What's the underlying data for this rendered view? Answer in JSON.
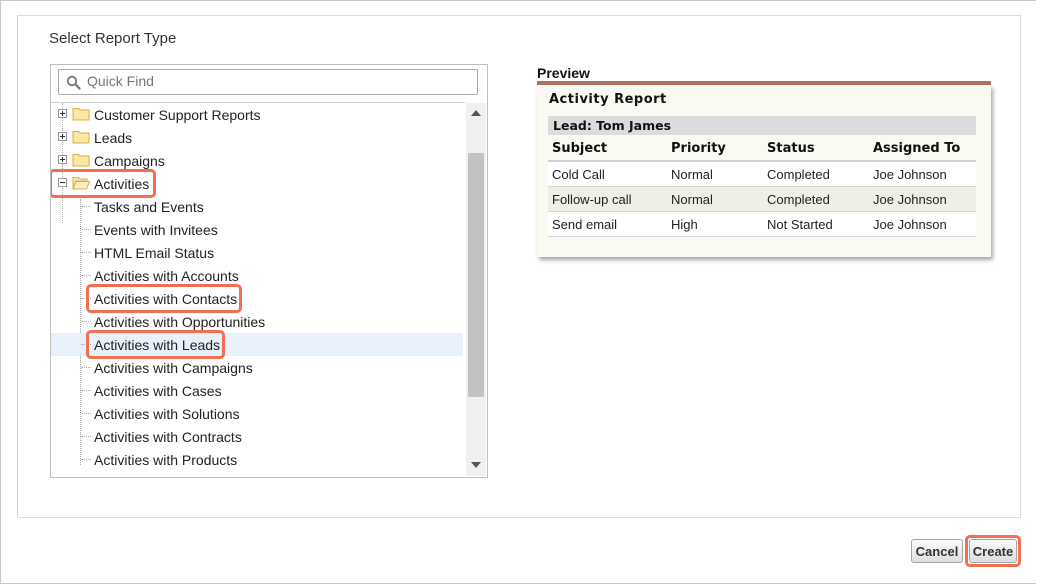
{
  "dialog": {
    "heading": "Select Report Type"
  },
  "search": {
    "placeholder": "Quick Find",
    "value": ""
  },
  "tree": {
    "folders": [
      {
        "label": "Customer Support Reports",
        "expanded": false
      },
      {
        "label": "Leads",
        "expanded": false
      },
      {
        "label": "Campaigns",
        "expanded": false
      },
      {
        "label": "Activities",
        "expanded": true
      }
    ],
    "children": [
      {
        "label": "Tasks and Events"
      },
      {
        "label": "Events with Invitees"
      },
      {
        "label": "HTML Email Status"
      },
      {
        "label": "Activities with Accounts"
      },
      {
        "label": "Activities with Contacts"
      },
      {
        "label": "Activities with Opportunities"
      },
      {
        "label": "Activities with Leads",
        "selected": true
      },
      {
        "label": "Activities with Campaigns"
      },
      {
        "label": "Activities with Cases"
      },
      {
        "label": "Activities with Solutions"
      },
      {
        "label": "Activities with Contracts"
      },
      {
        "label": "Activities with Products"
      }
    ]
  },
  "preview": {
    "label": "Preview",
    "title": "Activity Report",
    "group": "Lead: Tom James",
    "columns": [
      "Subject",
      "Priority",
      "Status",
      "Assigned To"
    ],
    "rows": [
      [
        "Cold Call",
        "Normal",
        "Completed",
        "Joe Johnson"
      ],
      [
        "Follow-up call",
        "Normal",
        "Completed",
        "Joe Johnson"
      ],
      [
        "Send email",
        "High",
        "Not Started",
        "Joe Johnson"
      ]
    ]
  },
  "buttons": {
    "cancel": "Cancel",
    "create": "Create"
  },
  "colors": {
    "highlight": "#f26f4f",
    "selection": "#e8f0fb",
    "preview_bar": "#b0735f"
  }
}
